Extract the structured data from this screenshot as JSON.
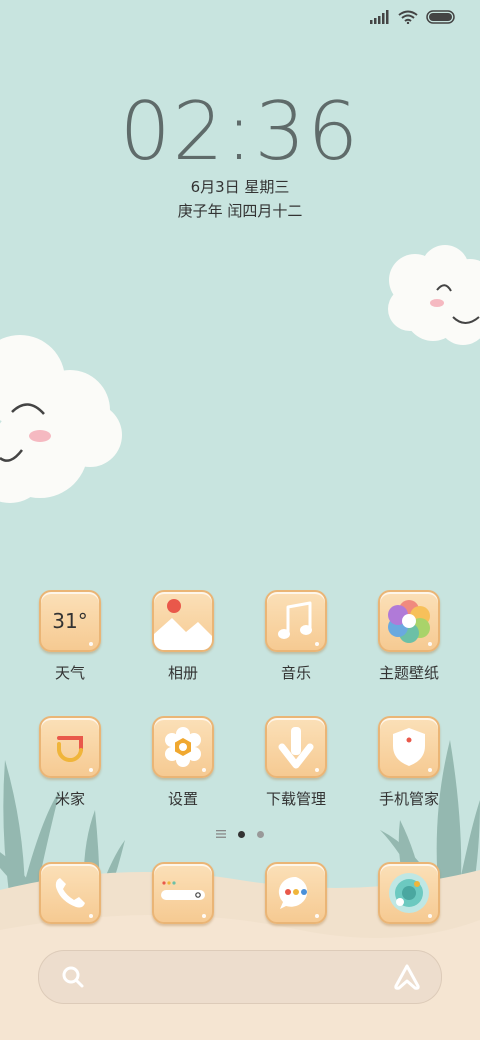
{
  "status_bar": {
    "signal_icon": "signal-icon",
    "wifi_icon": "wifi-icon",
    "battery_icon": "battery-icon"
  },
  "lockclock": {
    "time": "02:36",
    "date": "6月3日 星期三",
    "lunar": "庚子年 闰四月十二"
  },
  "apps_row1": [
    {
      "label": "天气",
      "icon": "weather-icon",
      "temp": "31°"
    },
    {
      "label": "相册",
      "icon": "gallery-icon"
    },
    {
      "label": "音乐",
      "icon": "music-icon"
    },
    {
      "label": "主题壁纸",
      "icon": "themes-icon"
    }
  ],
  "apps_row2": [
    {
      "label": "米家",
      "icon": "mijia-icon"
    },
    {
      "label": "设置",
      "icon": "settings-icon"
    },
    {
      "label": "下载管理",
      "icon": "download-icon"
    },
    {
      "label": "手机管家",
      "icon": "security-icon"
    }
  ],
  "dock": [
    {
      "icon": "phone-icon"
    },
    {
      "icon": "browser-icon"
    },
    {
      "icon": "messages-icon"
    },
    {
      "icon": "app-store-icon"
    }
  ],
  "page_indicator": {
    "pages": 2,
    "current": 1
  },
  "colors": {
    "background": "#c8e4df",
    "tile": "#f6ca92",
    "tile_border": "#eab576",
    "text": "#333333"
  }
}
